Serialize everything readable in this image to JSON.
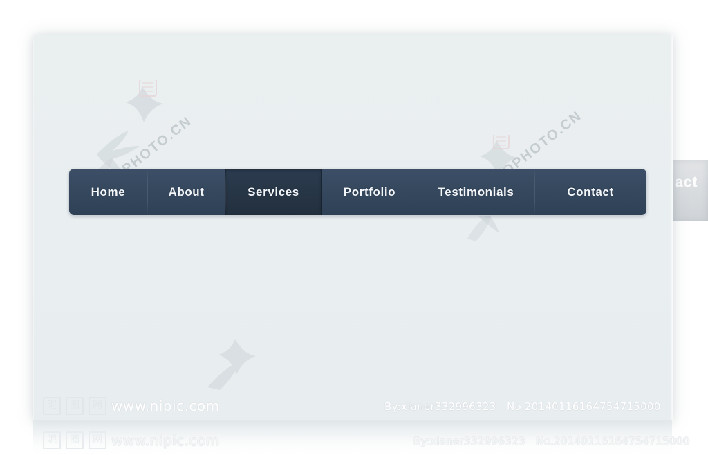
{
  "page": {
    "background_color": "#ffffff",
    "card_color": "#e9eef0"
  },
  "navbar": {
    "background_color": "#36495f",
    "active_color": "#273646",
    "text_color": "#f4f7fa",
    "items": [
      {
        "label": "Home",
        "active": false
      },
      {
        "label": "About",
        "active": false
      },
      {
        "label": "Services",
        "active": true
      },
      {
        "label": "Portfolio",
        "active": false
      },
      {
        "label": "Testimonials",
        "active": false
      },
      {
        "label": "Contact",
        "active": false
      }
    ]
  },
  "side_panel": {
    "label": "act",
    "background_color": "#d9dcdf"
  },
  "watermarks": {
    "diagonal_text_left": "TOPHOTO.CN",
    "diagonal_text_right": "TOPHOTO.CN",
    "nipic_mark_1": "昵",
    "nipic_mark_2": "图",
    "nipic_mark_3": "网",
    "nipic_url": "www.nipic.com",
    "credit_author": "By:xianer332996323",
    "credit_number": "No.20140116164754715000"
  }
}
